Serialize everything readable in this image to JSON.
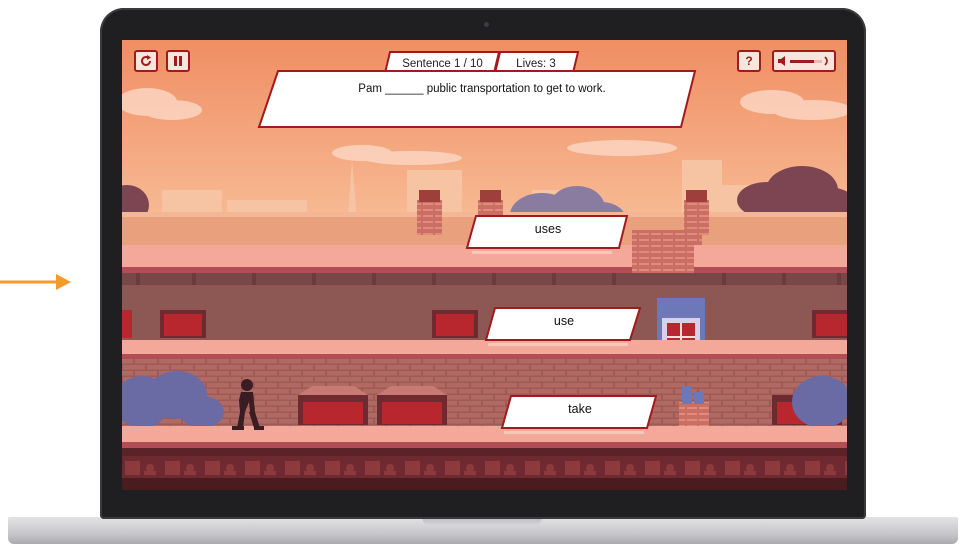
{
  "hud": {
    "sentence_counter": "Sentence 1 / 10",
    "lives": "Lives: 3",
    "help_label": "?"
  },
  "question": {
    "sentence": "Pam ______ public transportation to get to work."
  },
  "answers": [
    "uses",
    "use",
    "take"
  ],
  "icons": {
    "restart": "restart-icon",
    "pause": "pause-icon",
    "volume": "volume-icon",
    "pointer_arrow": "arrow-right-icon"
  },
  "colors": {
    "accent": "#a11a1d",
    "arrow": "#f39a2b",
    "panel": "#ffffff"
  }
}
